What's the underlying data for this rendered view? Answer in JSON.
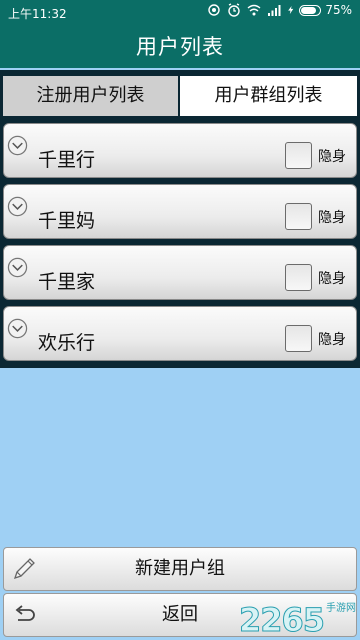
{
  "status_bar": {
    "time": "上午11:32",
    "battery_percent": "75%",
    "battery_level": 0.75,
    "icons": [
      "sync-icon",
      "alarm-icon",
      "wifi-icon",
      "signal-icon",
      "charging-icon"
    ]
  },
  "title_bar": {
    "title": "用户列表"
  },
  "tabs": [
    {
      "label": "注册用户列表",
      "selected": false
    },
    {
      "label": "用户群组列表",
      "selected": true
    }
  ],
  "groups": [
    {
      "name": "千里行",
      "hide_label": "隐身",
      "hidden": false
    },
    {
      "name": "千里妈",
      "hide_label": "隐身",
      "hidden": false
    },
    {
      "name": "千里家",
      "hide_label": "隐身",
      "hidden": false
    },
    {
      "name": "欢乐行",
      "hide_label": "隐身",
      "hidden": false
    }
  ],
  "buttons": {
    "new_group": "新建用户组",
    "back": "返回"
  },
  "watermark": {
    "number": "2265",
    "sub": "手游网"
  },
  "colors": {
    "header": "#0b6e66",
    "background": "#9fd0f4",
    "list_background": "#0b2733",
    "tab_selected": "#ffffff",
    "tab_unselected": "#cfcfcf"
  }
}
